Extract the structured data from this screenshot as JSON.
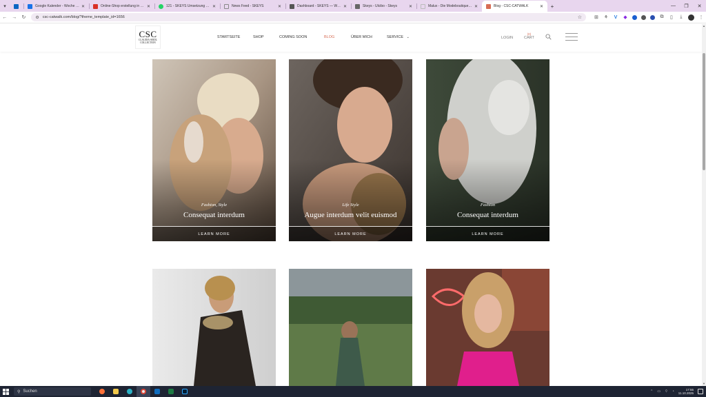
{
  "browser": {
    "tabs": [
      {
        "title": "",
        "favicon_color": "#0a66c2"
      },
      {
        "title": "Google Kalender - Woche von...",
        "favicon_color": "#1a73e8"
      },
      {
        "title": "Online-Shop erstellung in der...",
        "favicon_color": "#d93025"
      },
      {
        "title": "121 - SKEYS Umsetzung RACI ...",
        "favicon_color": "#25d366"
      },
      {
        "title": "News Feed - SKEYS",
        "favicon_color": "#888888"
      },
      {
        "title": "Dashboard - SKEYS — WordPr...",
        "favicon_color": "#555555"
      },
      {
        "title": "Skeys - Ulcibo - Skeys",
        "favicon_color": "#666666"
      },
      {
        "title": "Malux - Die Modeboutique - c...",
        "favicon_color": "#cccccc"
      },
      {
        "title": "Blog - CSC-CATWALK",
        "favicon_color": "#d76d55"
      }
    ],
    "url": "csc-catwalk.com/blog/?theme_template_id=1656"
  },
  "site": {
    "logo": {
      "big": "CSC",
      "small": "CLAUDIA SEIDL\nCOLLECTION"
    },
    "nav": [
      {
        "label": "STARTSEITE"
      },
      {
        "label": "SHOP"
      },
      {
        "label": "COMING SOON"
      },
      {
        "label": "BLOG"
      },
      {
        "label": "ÜBER MICH"
      },
      {
        "label": "SERVICE"
      }
    ],
    "login": "LOGIN",
    "cart": {
      "label": "CART",
      "count": "(0)"
    }
  },
  "cards": [
    {
      "category": "Fashion, Style",
      "title": "Consequat interdum",
      "button": "LEARN MORE"
    },
    {
      "category": "Life Style",
      "title": "Augue interdum velit euismod",
      "button": "LEARN MORE"
    },
    {
      "category": "Fashion",
      "title": "Consequat interdum",
      "button": "LEARN MORE"
    },
    {
      "category": "",
      "title": "",
      "button": ""
    },
    {
      "category": "",
      "title": "",
      "button": ""
    },
    {
      "category": "",
      "title": "",
      "button": ""
    }
  ],
  "taskbar": {
    "search_placeholder": "Suchen",
    "time": "17:55",
    "date": "11.10.2025"
  }
}
